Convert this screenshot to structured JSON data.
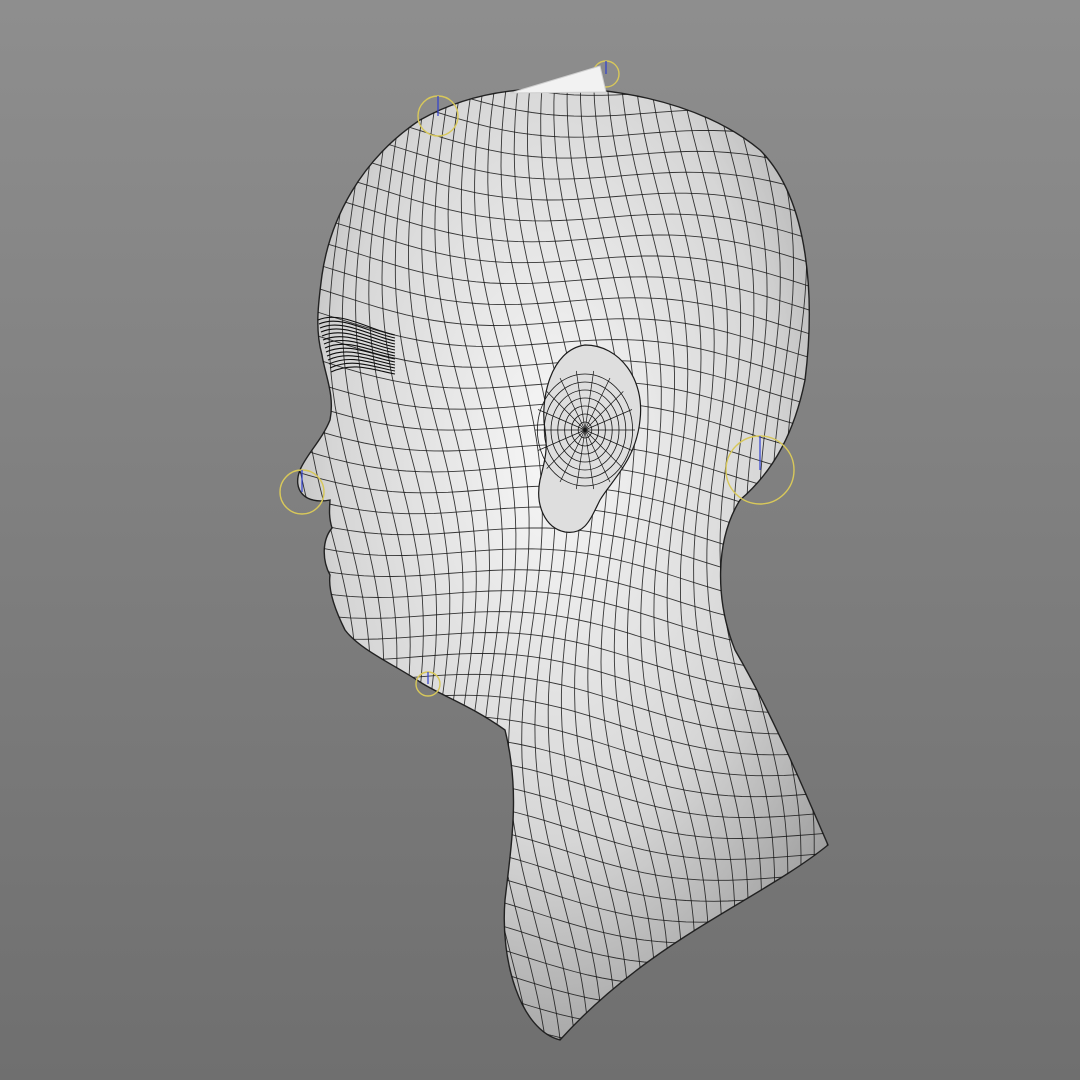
{
  "viewport": {
    "background_top": "#8e8e8e",
    "background_bottom": "#6f6f6f"
  },
  "model": {
    "shading_light": "#f7f7f7",
    "shading_mid": "#d6d6d6",
    "shading_dark": "#8d8d8d",
    "wire_color": "#161616",
    "gizmo_color": "#d8c85a",
    "axis_colors": [
      "#2f3fd0",
      "#3aa04a",
      "#c83a3a"
    ]
  },
  "controls": [
    {
      "name": "control-crown-back",
      "icon": "rig-control-circle-icon"
    },
    {
      "name": "control-crown-top",
      "icon": "rig-control-circle-icon"
    },
    {
      "name": "control-nose",
      "icon": "rig-control-circle-icon"
    },
    {
      "name": "control-neck-back",
      "icon": "rig-control-circle-icon"
    },
    {
      "name": "control-chin",
      "icon": "rig-control-circle-icon"
    }
  ]
}
